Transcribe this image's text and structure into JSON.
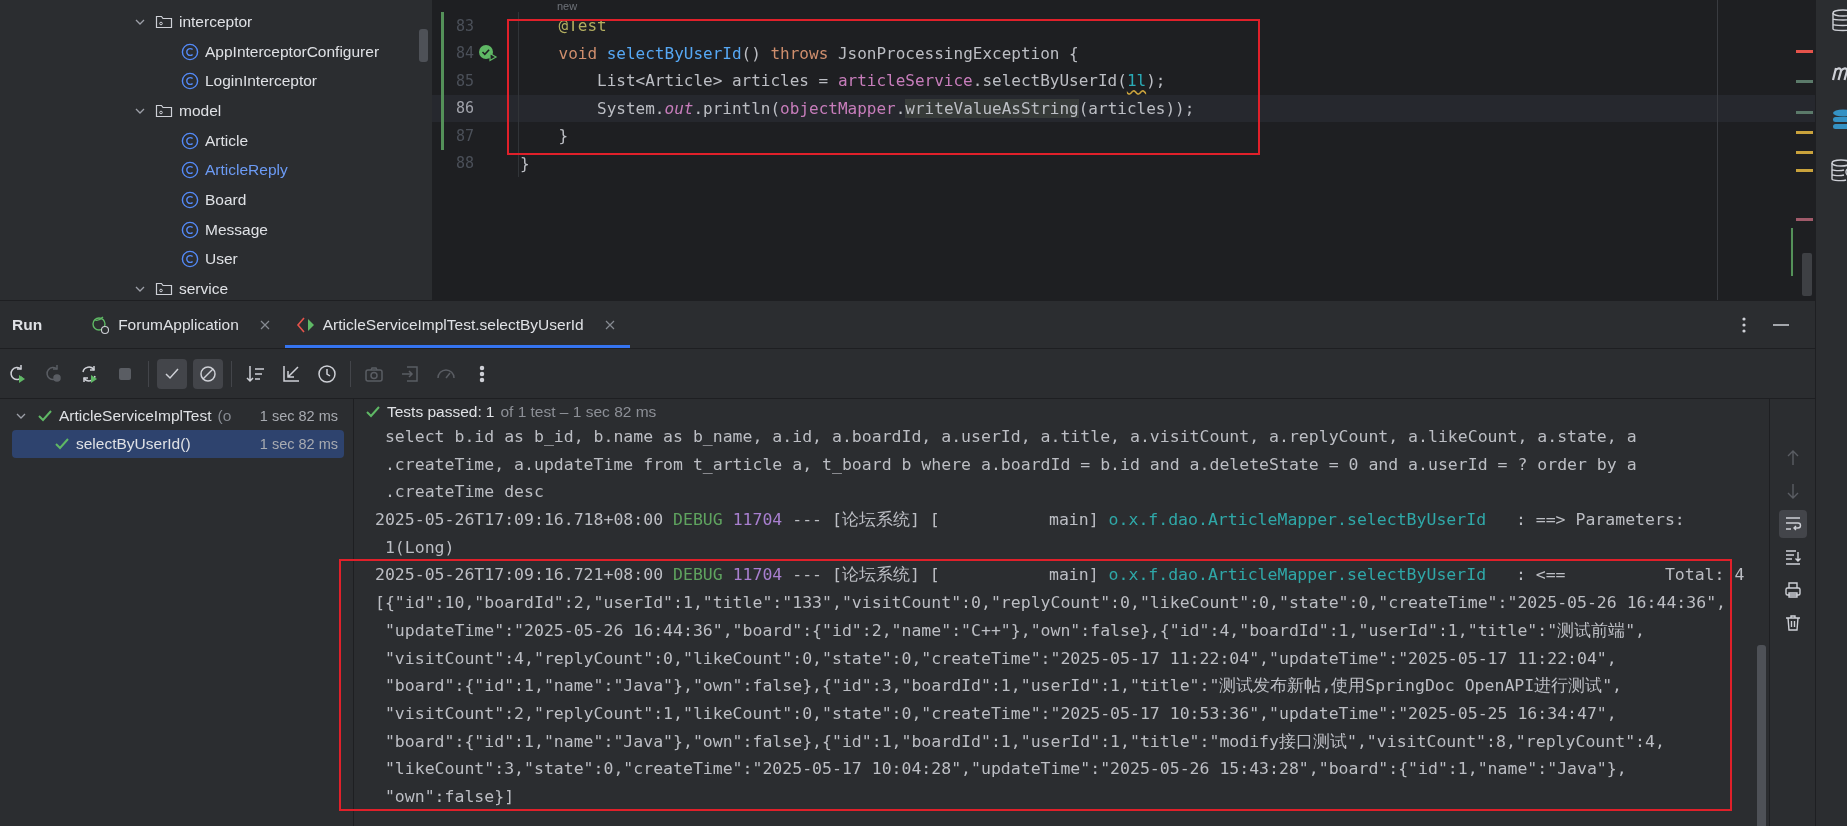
{
  "project_tree": [
    {
      "label": "interceptor",
      "kind": "package",
      "expanded": true,
      "modified": false,
      "children": [
        {
          "label": "AppInterceptorConfigurer",
          "kind": "class",
          "modified": false
        },
        {
          "label": "LoginInterceptor",
          "kind": "class",
          "modified": false
        }
      ]
    },
    {
      "label": "model",
      "kind": "package",
      "expanded": true,
      "modified": false,
      "children": [
        {
          "label": "Article",
          "kind": "class",
          "modified": false
        },
        {
          "label": "ArticleReply",
          "kind": "class",
          "modified": true
        },
        {
          "label": "Board",
          "kind": "class",
          "modified": false
        },
        {
          "label": "Message",
          "kind": "class",
          "modified": false
        },
        {
          "label": "User",
          "kind": "class",
          "modified": false
        }
      ]
    },
    {
      "label": "service",
      "kind": "package",
      "expanded": true,
      "modified": false
    }
  ],
  "editor": {
    "usage_hint": "new",
    "lines": [
      {
        "number": "83",
        "current": false,
        "changed": true,
        "test_marker": false,
        "tokens": [
          {
            "kind": "annotation",
            "text": "    @Test"
          }
        ]
      },
      {
        "number": "84",
        "current": false,
        "changed": true,
        "test_marker": true,
        "tokens": [
          {
            "kind": "keyword",
            "text": "    void "
          },
          {
            "kind": "declaration",
            "text": "selectByUserId"
          },
          {
            "kind": "plain",
            "text": "() "
          },
          {
            "kind": "keyword",
            "text": "throws"
          },
          {
            "kind": "plain",
            "text": " JsonProcessingException {"
          }
        ]
      },
      {
        "number": "85",
        "current": false,
        "changed": true,
        "test_marker": false,
        "tokens": [
          {
            "kind": "plain",
            "text": "        List<Article> articles = "
          },
          {
            "kind": "field",
            "text": "articleService"
          },
          {
            "kind": "plain",
            "text": ".selectByUserId("
          },
          {
            "kind": "number_warning",
            "text": "1l"
          },
          {
            "kind": "plain",
            "text": ");"
          }
        ]
      },
      {
        "number": "86",
        "current": true,
        "changed": true,
        "test_marker": false,
        "tokens": [
          {
            "kind": "plain",
            "text": "        System."
          },
          {
            "kind": "static_field",
            "text": "out"
          },
          {
            "kind": "plain",
            "text": ".println("
          },
          {
            "kind": "field",
            "text": "objectMapper"
          },
          {
            "kind": "plain",
            "text": "."
          },
          {
            "kind": "highlighted",
            "text": "writeValueAsString"
          },
          {
            "kind": "plain",
            "text": "(articles));"
          }
        ]
      },
      {
        "number": "87",
        "current": false,
        "changed": true,
        "test_marker": false,
        "tokens": [
          {
            "kind": "plain",
            "text": "    }"
          }
        ]
      },
      {
        "number": "88",
        "current": false,
        "changed": false,
        "test_marker": false,
        "tokens": [
          {
            "kind": "plain",
            "text": "}"
          }
        ]
      }
    ]
  },
  "run": {
    "title": "Run",
    "tabs": [
      {
        "label": "ForumApplication",
        "kind": "app",
        "selected": false
      },
      {
        "label": "ArticleServiceImplTest.selectByUserId",
        "kind": "test",
        "selected": true
      }
    ],
    "toolbar": [
      [
        {
          "kind": "rerun",
          "disabled": false,
          "toggled": false
        },
        {
          "kind": "rerun_failed",
          "disabled": true,
          "toggled": false
        },
        {
          "kind": "auto_rerun",
          "disabled": false,
          "toggled": false
        },
        {
          "kind": "stop",
          "disabled": true,
          "toggled": false
        }
      ],
      [
        {
          "kind": "show_passed",
          "disabled": false,
          "toggled": true
        },
        {
          "kind": "show_ignored",
          "disabled": false,
          "toggled": true
        }
      ],
      [
        {
          "kind": "sort",
          "disabled": false,
          "toggled": false
        },
        {
          "kind": "import",
          "disabled": false,
          "toggled": false
        },
        {
          "kind": "history",
          "disabled": false,
          "toggled": false
        }
      ],
      [
        {
          "kind": "screenshot",
          "disabled": true,
          "toggled": false
        },
        {
          "kind": "export",
          "disabled": true,
          "toggled": false
        },
        {
          "kind": "gauge",
          "disabled": true,
          "toggled": false
        },
        {
          "kind": "more",
          "disabled": false,
          "toggled": false
        }
      ]
    ],
    "test_tree": [
      {
        "label": "ArticleServiceImplTest",
        "location": "(o",
        "duration": "1 sec 82 ms",
        "passed": true,
        "expanded": true,
        "selected": false,
        "children": [
          {
            "label": "selectByUserId()",
            "duration": "1 sec 82 ms",
            "passed": true,
            "selected": true
          }
        ]
      }
    ],
    "status": {
      "label": "Tests passed:",
      "count": "1",
      "detail": "of 1 test – 1 sec 82 ms",
      "passed": true
    },
    "console": [
      {
        "segments": [
          {
            "kind": "plain",
            "text": " select b.id as b_id, b.name as b_name, a.id, a.boardId, a.userId, a.title, a.visitCount, a.replyCount, a.likeCount, a.state, a"
          }
        ]
      },
      {
        "segments": [
          {
            "kind": "plain",
            "text": " .createTime, a.updateTime from t_article a, t_board b where a.boardId = b.id and a.deleteState = 0 and a.userId = ? order by a"
          }
        ]
      },
      {
        "segments": [
          {
            "kind": "plain",
            "text": " .createTime desc"
          }
        ]
      },
      {
        "segments": [
          {
            "kind": "plain",
            "text": "2025-05-26T17:09:16.718+08:00 "
          },
          {
            "kind": "level",
            "text": "DEBUG "
          },
          {
            "kind": "pid",
            "text": "11704"
          },
          {
            "kind": "plain",
            "text": " --- [论坛系统] [           main] "
          },
          {
            "kind": "logger",
            "text": "o.x.f.dao.ArticleMapper.selectByUserId"
          },
          {
            "kind": "plain",
            "text": "   : ==> Parameters:"
          }
        ]
      },
      {
        "segments": [
          {
            "kind": "plain",
            "text": " 1(Long)"
          }
        ]
      },
      {
        "segments": [
          {
            "kind": "plain",
            "text": "2025-05-26T17:09:16.721+08:00 "
          },
          {
            "kind": "level",
            "text": "DEBUG "
          },
          {
            "kind": "pid",
            "text": "11704"
          },
          {
            "kind": "plain",
            "text": " --- [论坛系统] [           main] "
          },
          {
            "kind": "logger",
            "text": "o.x.f.dao.ArticleMapper.selectByUserId"
          },
          {
            "kind": "plain",
            "text": "   : <==          Total: 4"
          }
        ]
      },
      {
        "segments": [
          {
            "kind": "plain",
            "text": "[{\"id\":10,\"boardId\":2,\"userId\":1,\"title\":\"133\",\"visitCount\":0,\"replyCount\":0,\"likeCount\":0,\"state\":0,\"createTime\":\"2025-05-26 16:44:36\","
          }
        ]
      },
      {
        "segments": [
          {
            "kind": "plain",
            "text": " \"updateTime\":\"2025-05-26 16:44:36\",\"board\":{\"id\":2,\"name\":\"C++\"},\"own\":false},{\"id\":4,\"boardId\":1,\"userId\":1,\"title\":\"测试前端\","
          }
        ]
      },
      {
        "segments": [
          {
            "kind": "plain",
            "text": " \"visitCount\":4,\"replyCount\":0,\"likeCount\":0,\"state\":0,\"createTime\":\"2025-05-17 11:22:04\",\"updateTime\":\"2025-05-17 11:22:04\","
          }
        ]
      },
      {
        "segments": [
          {
            "kind": "plain",
            "text": " \"board\":{\"id\":1,\"name\":\"Java\"},\"own\":false},{\"id\":3,\"boardId\":1,\"userId\":1,\"title\":\"测试发布新帖,使用SpringDoc OpenAPI进行测试\","
          }
        ]
      },
      {
        "segments": [
          {
            "kind": "plain",
            "text": " \"visitCount\":2,\"replyCount\":1,\"likeCount\":0,\"state\":0,\"createTime\":\"2025-05-17 10:53:36\",\"updateTime\":\"2025-05-25 16:34:47\","
          }
        ]
      },
      {
        "segments": [
          {
            "kind": "plain",
            "text": " \"board\":{\"id\":1,\"name\":\"Java\"},\"own\":false},{\"id\":1,\"boardId\":1,\"userId\":1,\"title\":\"modify接口测试\",\"visitCount\":8,\"replyCount\":4,"
          }
        ]
      },
      {
        "segments": [
          {
            "kind": "plain",
            "text": " \"likeCount\":3,\"state\":0,\"createTime\":\"2025-05-17 10:04:28\",\"updateTime\":\"2025-05-26 15:43:28\",\"board\":{\"id\":1,\"name\":\"Java\"},"
          }
        ]
      },
      {
        "segments": [
          {
            "kind": "plain",
            "text": " \"own\":false}]"
          }
        ]
      }
    ],
    "console_actions": [
      {
        "kind": "up",
        "disabled": true,
        "toggled": false
      },
      {
        "kind": "down",
        "disabled": true,
        "toggled": false
      },
      {
        "kind": "soft_wrap",
        "disabled": false,
        "toggled": true
      },
      {
        "kind": "scroll_end",
        "disabled": false,
        "toggled": false
      },
      {
        "kind": "print",
        "disabled": false,
        "toggled": false
      },
      {
        "kind": "clear",
        "disabled": false,
        "toggled": false
      }
    ]
  }
}
